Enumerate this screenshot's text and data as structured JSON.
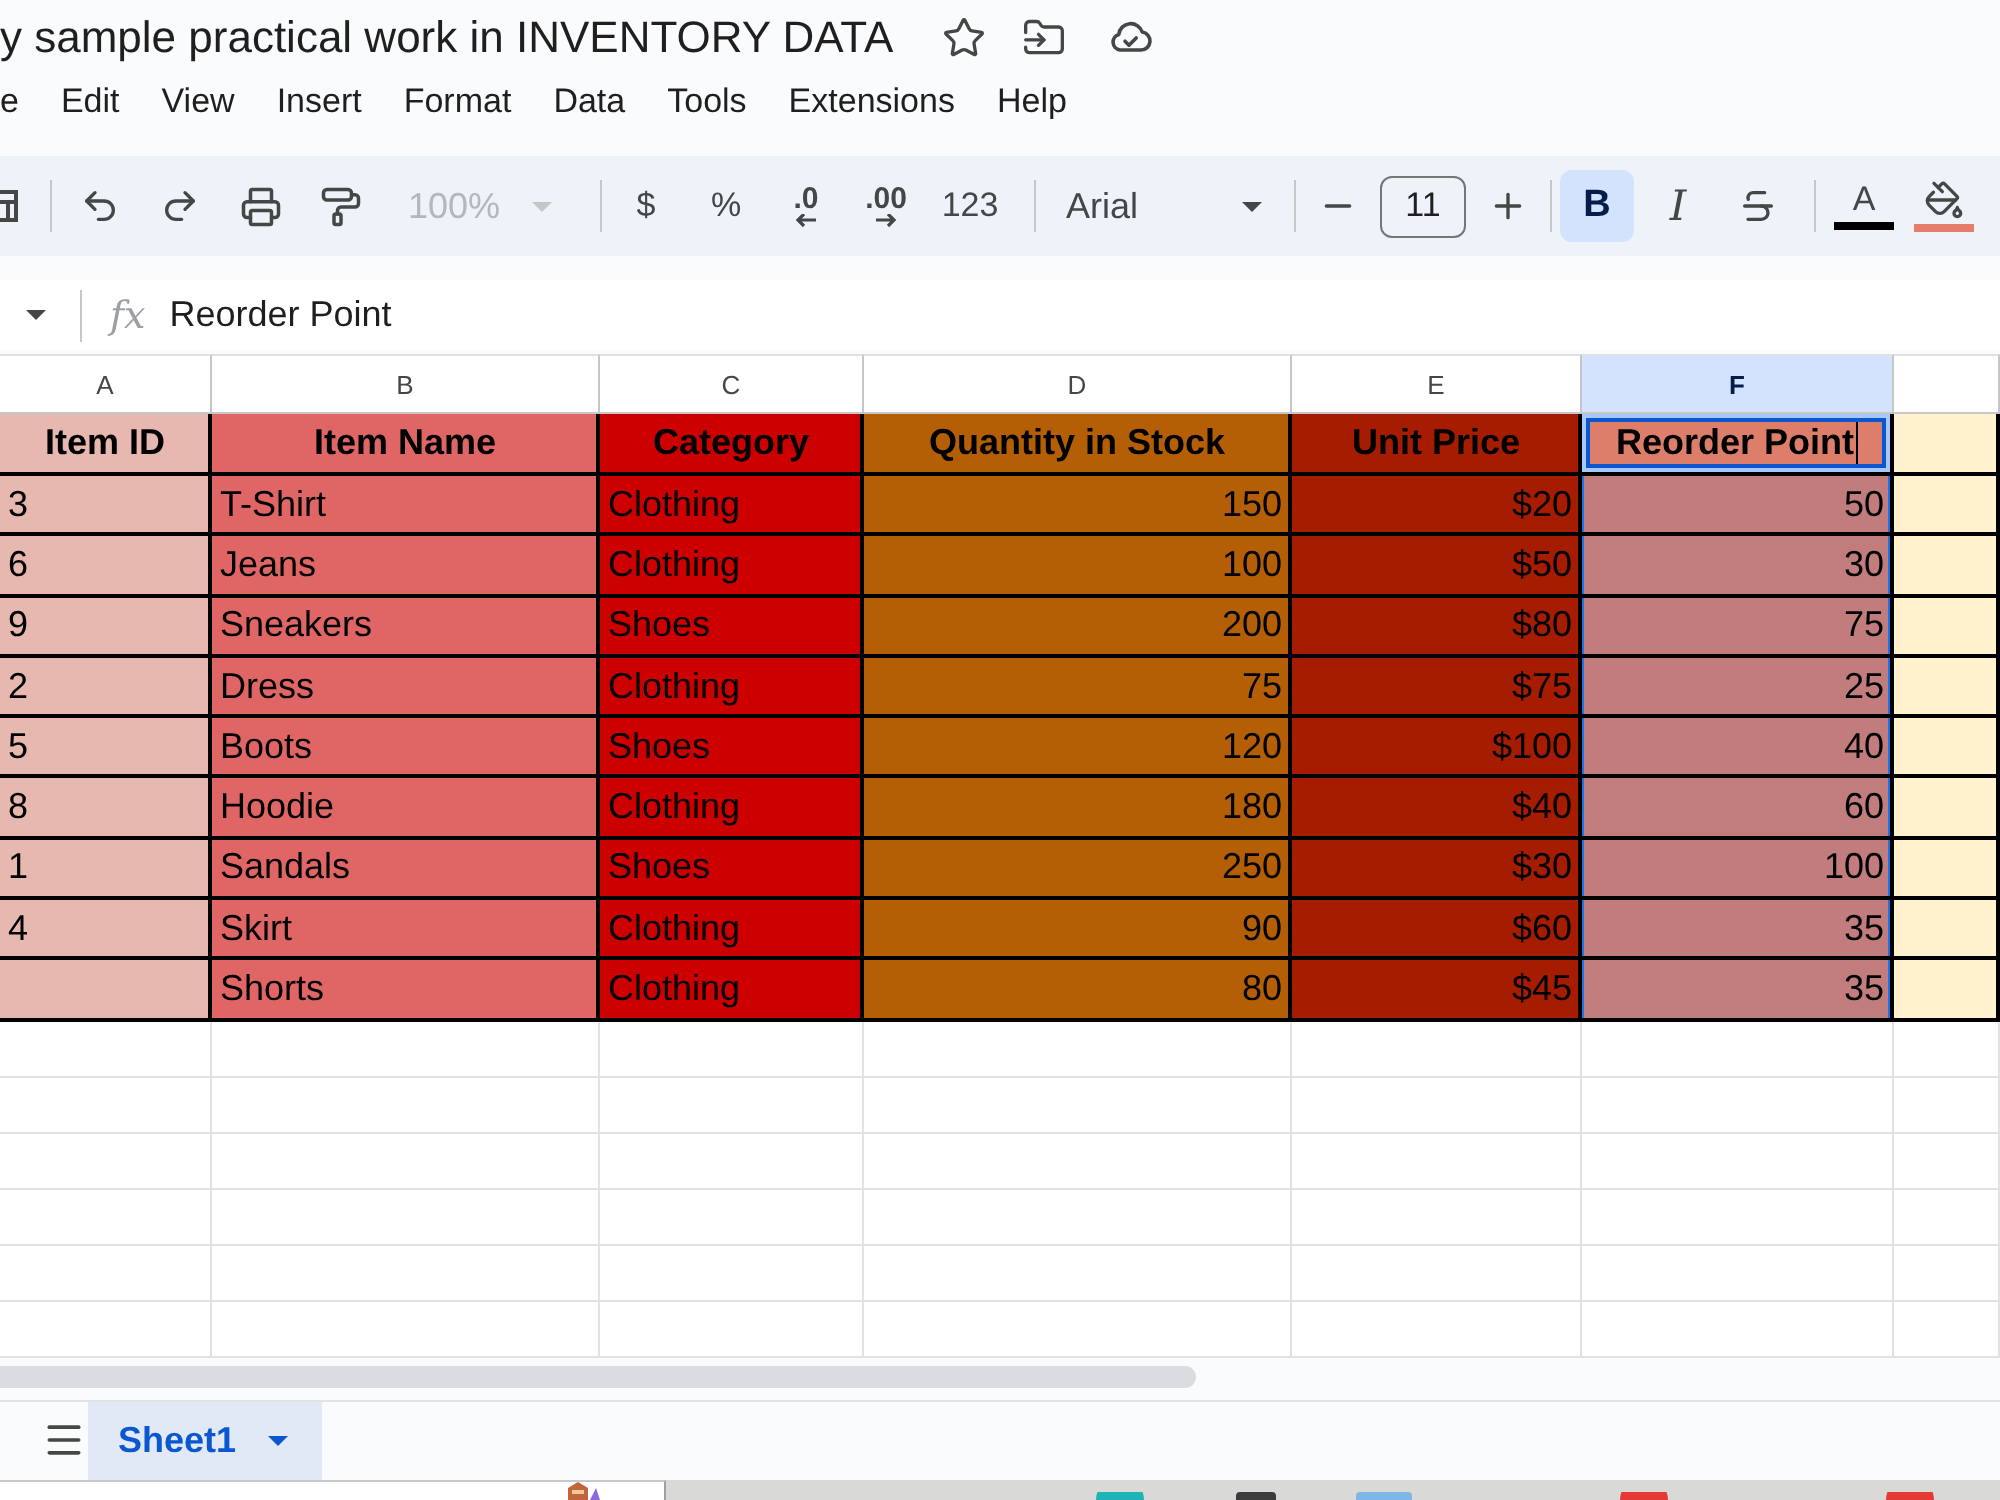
{
  "title": "y sample practical work in INVENTORY DATA",
  "menu": [
    "e",
    "Edit",
    "View",
    "Insert",
    "Format",
    "Data",
    "Tools",
    "Extensions",
    "Help"
  ],
  "toolbar": {
    "zoom": {
      "value": "100%",
      "disabled": true
    },
    "currency": "$",
    "percent": "%",
    "decimals": [
      {
        "kind": "decrease",
        "label": ".0"
      },
      {
        "kind": "increase",
        "label": ".00"
      }
    ],
    "number_format": "123",
    "font": "Arial",
    "font_size": "11",
    "text_styles": [
      {
        "kind": "bold",
        "label": "B",
        "selected": true
      },
      {
        "kind": "italic",
        "label": "I",
        "selected": false
      },
      {
        "kind": "strikethrough",
        "selected": false
      }
    ],
    "colors": [
      {
        "kind": "text",
        "label": "A",
        "color": "#000000"
      },
      {
        "kind": "fill",
        "color": "#e67c6b"
      }
    ]
  },
  "formula_bar": {
    "fx": "fx",
    "content": "Reorder Point"
  },
  "sheet": {
    "columns": [
      {
        "letter": "A",
        "kind": "text",
        "color": "#e6b8af",
        "selected": false
      },
      {
        "letter": "B",
        "kind": "text",
        "color": "#e06666",
        "selected": false
      },
      {
        "letter": "C",
        "kind": "text",
        "color": "#cc0000",
        "selected": false
      },
      {
        "letter": "D",
        "kind": "number",
        "color": "#b45f06",
        "selected": false
      },
      {
        "letter": "E",
        "kind": "number",
        "color": "#a61c00",
        "selected": false
      },
      {
        "letter": "F",
        "kind": "number",
        "color": "#dd7e6b",
        "selected": true
      },
      {
        "color": "#fff2cc",
        "selected": false
      }
    ],
    "header": [
      {
        "text": "Item ID",
        "selected": false,
        "editing": false
      },
      {
        "text": "Item Name",
        "selected": false,
        "editing": false
      },
      {
        "text": "Category",
        "selected": false,
        "editing": false
      },
      {
        "text": "Quantity in Stock",
        "selected": false,
        "editing": false
      },
      {
        "text": "Unit Price",
        "selected": false,
        "editing": false
      },
      {
        "text": "Reorder Point",
        "selected": true,
        "editing": true
      }
    ],
    "rows": [
      {
        "item_id": "3",
        "item_name": "T-Shirt",
        "category": "Clothing",
        "quantity_in_stock": "150",
        "unit_price": "$20",
        "reorder_point": "50"
      },
      {
        "item_id": "6",
        "item_name": "Jeans",
        "category": "Clothing",
        "quantity_in_stock": "100",
        "unit_price": "$50",
        "reorder_point": "30"
      },
      {
        "item_id": "9",
        "item_name": "Sneakers",
        "category": "Shoes",
        "quantity_in_stock": "200",
        "unit_price": "$80",
        "reorder_point": "75"
      },
      {
        "item_id": "2",
        "item_name": "Dress",
        "category": "Clothing",
        "quantity_in_stock": "75",
        "unit_price": "$75",
        "reorder_point": "25"
      },
      {
        "item_id": "5",
        "item_name": "Boots",
        "category": "Shoes",
        "quantity_in_stock": "120",
        "unit_price": "$100",
        "reorder_point": "40"
      },
      {
        "item_id": "8",
        "item_name": "Hoodie",
        "category": "Clothing",
        "quantity_in_stock": "180",
        "unit_price": "$40",
        "reorder_point": "60"
      },
      {
        "item_id": "1",
        "item_name": "Sandals",
        "category": "Shoes",
        "quantity_in_stock": "250",
        "unit_price": "$30",
        "reorder_point": "100"
      },
      {
        "item_id": "4",
        "item_name": "Skirt",
        "category": "Clothing",
        "quantity_in_stock": "90",
        "unit_price": "$60",
        "reorder_point": "35"
      },
      {
        "item_name": "Shorts",
        "category": "Clothing",
        "quantity_in_stock": "80",
        "unit_price": "$45",
        "reorder_point": "35"
      }
    ]
  },
  "sheet_tabs": [
    {
      "label": "Sheet1",
      "selected": true
    }
  ]
}
